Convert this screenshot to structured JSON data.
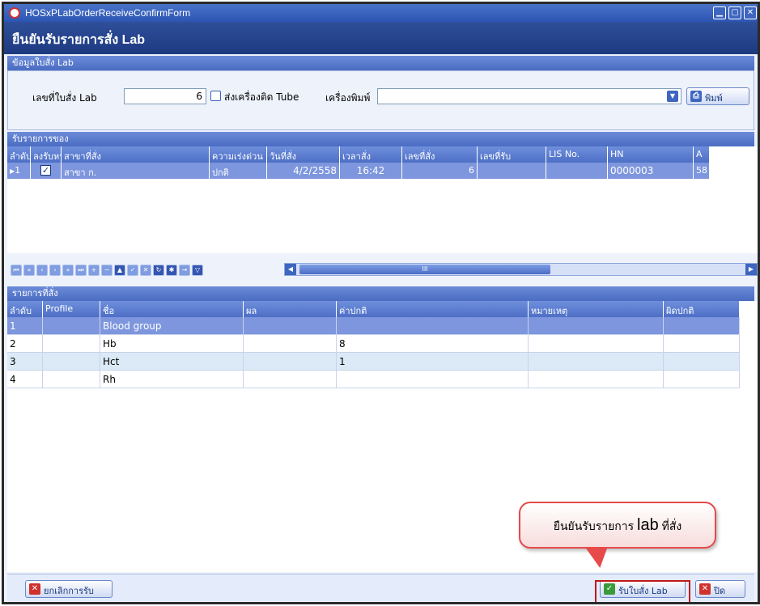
{
  "window": {
    "title": "HOSxPLabOrderReceiveConfirmForm",
    "header": "ยืนยันรับรายการสั่ง Lab"
  },
  "colors": {
    "title_bar": "#2b55b3",
    "header_band": "#1d3a80",
    "section_bar": "#4a6cc2",
    "selected_row": "#7d96dd",
    "alt_row": "#dbeaf6",
    "callout_border": "#e64a4a",
    "highlight_border": "#c01818"
  },
  "order_info": {
    "section_label": "ข้อมูลใบสั่ง Lab",
    "order_no_label": "เลขที่ใบสั่ง Lab",
    "order_no_value": "6",
    "tube_checkbox_label": "ส่งเครื่องติด Tube",
    "tube_checked": false,
    "printer_label": "เครื่องพิมพ์",
    "printer_value": "",
    "print_button": "พิมพ์",
    "print_icon": "printer-icon"
  },
  "receive_grid": {
    "section_label": "รับรายการของ",
    "columns": [
      "ลำดับ",
      "ลงรับหน",
      "สาขาที่สั่ง",
      "ความเร่งด่วน",
      "วันที่สั่ง",
      "เวลาสั่ง",
      "เลขที่สั่ง",
      "เลขที่รับ",
      "LIS No.",
      "HN",
      "A"
    ],
    "rows": [
      {
        "seq": "1",
        "received": true,
        "branch": "สาขา ก.",
        "urgency": "ปกติ",
        "date": "4/2/2558",
        "time": "16:42",
        "order_no": "6",
        "receive_no": "",
        "lis_no": "",
        "hn": "0000003",
        "age": "58"
      }
    ],
    "scroll_thumb_glyph": "III"
  },
  "items_grid": {
    "section_label": "รายการที่สั่ง",
    "columns": [
      "ลำดับ",
      "Profile",
      "ชื่อ",
      "ผล",
      "ค่าปกติ",
      "หมายเหตุ",
      "ผิดปกติ"
    ],
    "rows": [
      {
        "seq": "1",
        "profile": "",
        "name": "Blood group",
        "result": "",
        "normal": "",
        "note": "",
        "abnormal": ""
      },
      {
        "seq": "2",
        "profile": "",
        "name": "Hb",
        "result": "",
        "normal": "8",
        "note": "",
        "abnormal": ""
      },
      {
        "seq": "3",
        "profile": "",
        "name": "Hct",
        "result": "",
        "normal": "1",
        "note": "",
        "abnormal": ""
      },
      {
        "seq": "4",
        "profile": "",
        "name": "Rh",
        "result": "",
        "normal": "",
        "note": "",
        "abnormal": ""
      }
    ]
  },
  "callout": {
    "text_before": "ยืนยันรับรายการ ",
    "text_big": "lab",
    "text_after": " ที่สั่ง"
  },
  "footer": {
    "cancel_button": "ยกเลิกการรับ",
    "confirm_button": "รับใบสั่ง Lab",
    "close_button": "ปิด"
  }
}
